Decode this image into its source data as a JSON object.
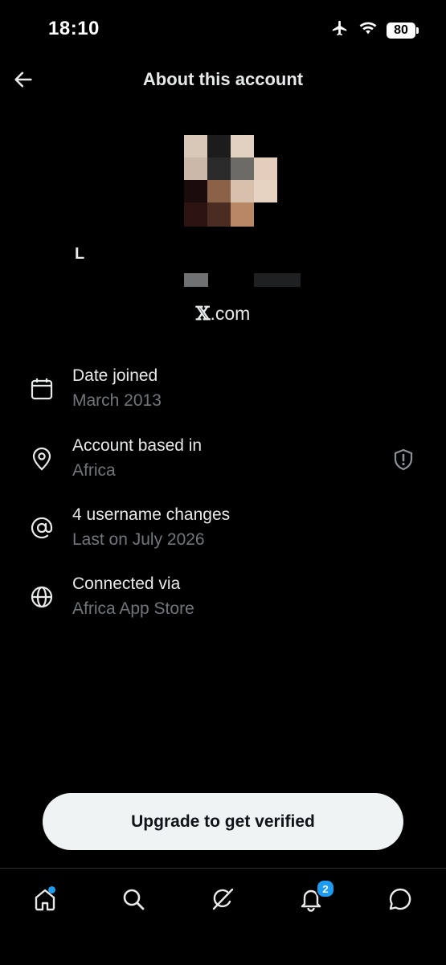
{
  "status_bar": {
    "time": "18:10",
    "battery": "80"
  },
  "header": {
    "title": "About this account"
  },
  "profile": {
    "name": "L",
    "domain_logo": "𝕏",
    "domain_suffix": ".com"
  },
  "rows": [
    {
      "title": "Date joined",
      "subtitle": "March 2013",
      "icon": "calendar-icon"
    },
    {
      "title": "Account based in",
      "subtitle": "Africa",
      "icon": "location-pin-icon",
      "trailing_icon": "shield-alert-icon"
    },
    {
      "title": "4 username changes",
      "subtitle": "Last on July 2026",
      "icon": "at-sign-icon"
    },
    {
      "title": "Connected via",
      "subtitle": "Africa App Store",
      "icon": "globe-icon"
    }
  ],
  "cta": {
    "label": "Upgrade to get verified"
  },
  "nav": {
    "items": [
      "home-icon",
      "search-icon",
      "grok-icon",
      "bell-icon",
      "messages-icon"
    ],
    "notifications_badge": "2"
  },
  "colors": {
    "background": "#000000",
    "primary_text": "#e7e9ea",
    "secondary_text": "#71767b",
    "accent": "#1d9bf0",
    "button_bg": "#eff3f4"
  }
}
